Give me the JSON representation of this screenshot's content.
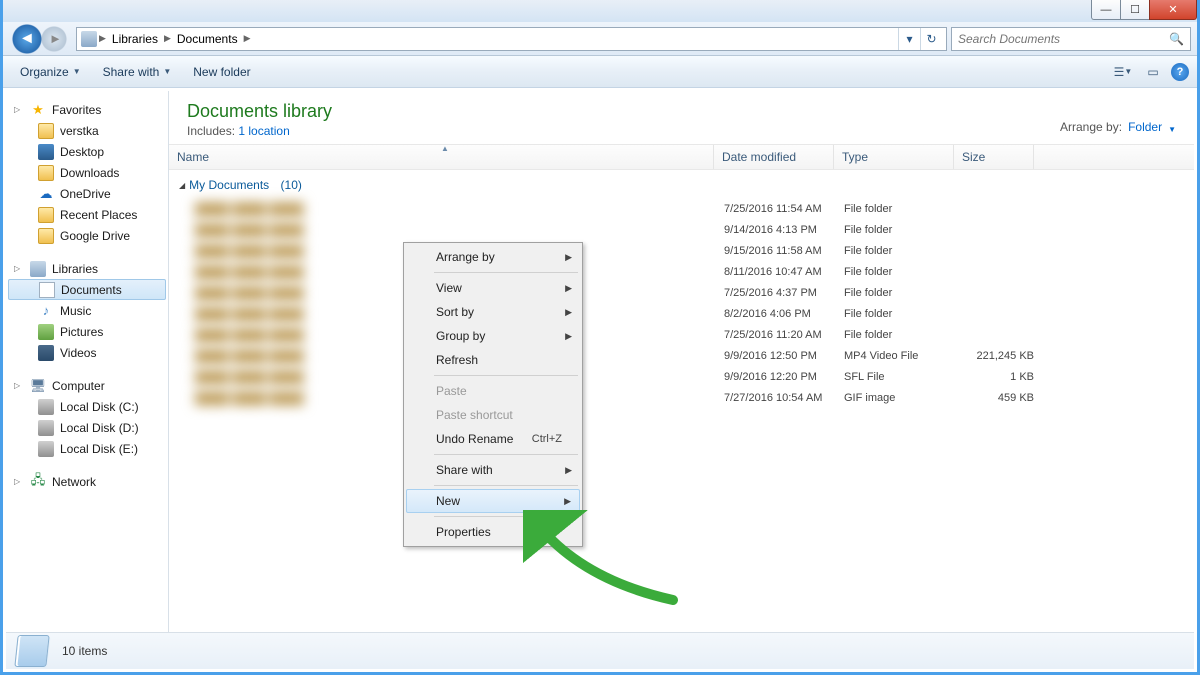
{
  "breadcrumb": {
    "root_icon": "libraries",
    "items": [
      "Libraries",
      "Documents"
    ]
  },
  "search": {
    "placeholder": "Search Documents"
  },
  "toolbar": {
    "organize": "Organize",
    "share": "Share with",
    "newfolder": "New folder"
  },
  "sidebar": {
    "favorites": {
      "label": "Favorites",
      "items": [
        "verstka",
        "Desktop",
        "Downloads",
        "OneDrive",
        "Recent Places",
        "Google Drive"
      ]
    },
    "libraries": {
      "label": "Libraries",
      "items": [
        "Documents",
        "Music",
        "Pictures",
        "Videos"
      ],
      "selected": "Documents"
    },
    "computer": {
      "label": "Computer",
      "items": [
        "Local Disk (C:)",
        "Local Disk (D:)",
        "Local Disk (E:)"
      ]
    },
    "network": {
      "label": "Network"
    }
  },
  "library_header": {
    "title": "Documents library",
    "includes_label": "Includes:",
    "includes_link": "1 location",
    "arrange_label": "Arrange by:",
    "arrange_value": "Folder"
  },
  "columns": {
    "name": "Name",
    "date": "Date modified",
    "type": "Type",
    "size": "Size"
  },
  "group": {
    "label": "My Documents",
    "count": "(10)"
  },
  "rows": [
    {
      "date": "7/25/2016 11:54 AM",
      "type": "File folder",
      "size": ""
    },
    {
      "date": "9/14/2016 4:13 PM",
      "type": "File folder",
      "size": ""
    },
    {
      "date": "9/15/2016 11:58 AM",
      "type": "File folder",
      "size": ""
    },
    {
      "date": "8/11/2016 10:47 AM",
      "type": "File folder",
      "size": ""
    },
    {
      "date": "7/25/2016 4:37 PM",
      "type": "File folder",
      "size": ""
    },
    {
      "date": "8/2/2016 4:06 PM",
      "type": "File folder",
      "size": ""
    },
    {
      "date": "7/25/2016 11:20 AM",
      "type": "File folder",
      "size": ""
    },
    {
      "date": "9/9/2016 12:50 PM",
      "type": "MP4 Video File",
      "size": "221,245 KB"
    },
    {
      "date": "9/9/2016 12:20 PM",
      "type": "SFL File",
      "size": "1 KB"
    },
    {
      "date": "7/27/2016 10:54 AM",
      "type": "GIF image",
      "size": "459 KB"
    }
  ],
  "context_menu": [
    {
      "label": "Arrange by",
      "sub": true
    },
    {
      "sep": true
    },
    {
      "label": "View",
      "sub": true
    },
    {
      "label": "Sort by",
      "sub": true
    },
    {
      "label": "Group by",
      "sub": true
    },
    {
      "label": "Refresh"
    },
    {
      "sep": true
    },
    {
      "label": "Paste",
      "disabled": true
    },
    {
      "label": "Paste shortcut",
      "disabled": true
    },
    {
      "label": "Undo Rename",
      "shortcut": "Ctrl+Z"
    },
    {
      "sep": true
    },
    {
      "label": "Share with",
      "sub": true
    },
    {
      "sep": true
    },
    {
      "label": "New",
      "sub": true,
      "hover": true
    },
    {
      "sep": true
    },
    {
      "label": "Properties"
    }
  ],
  "status": {
    "text": "10 items"
  }
}
